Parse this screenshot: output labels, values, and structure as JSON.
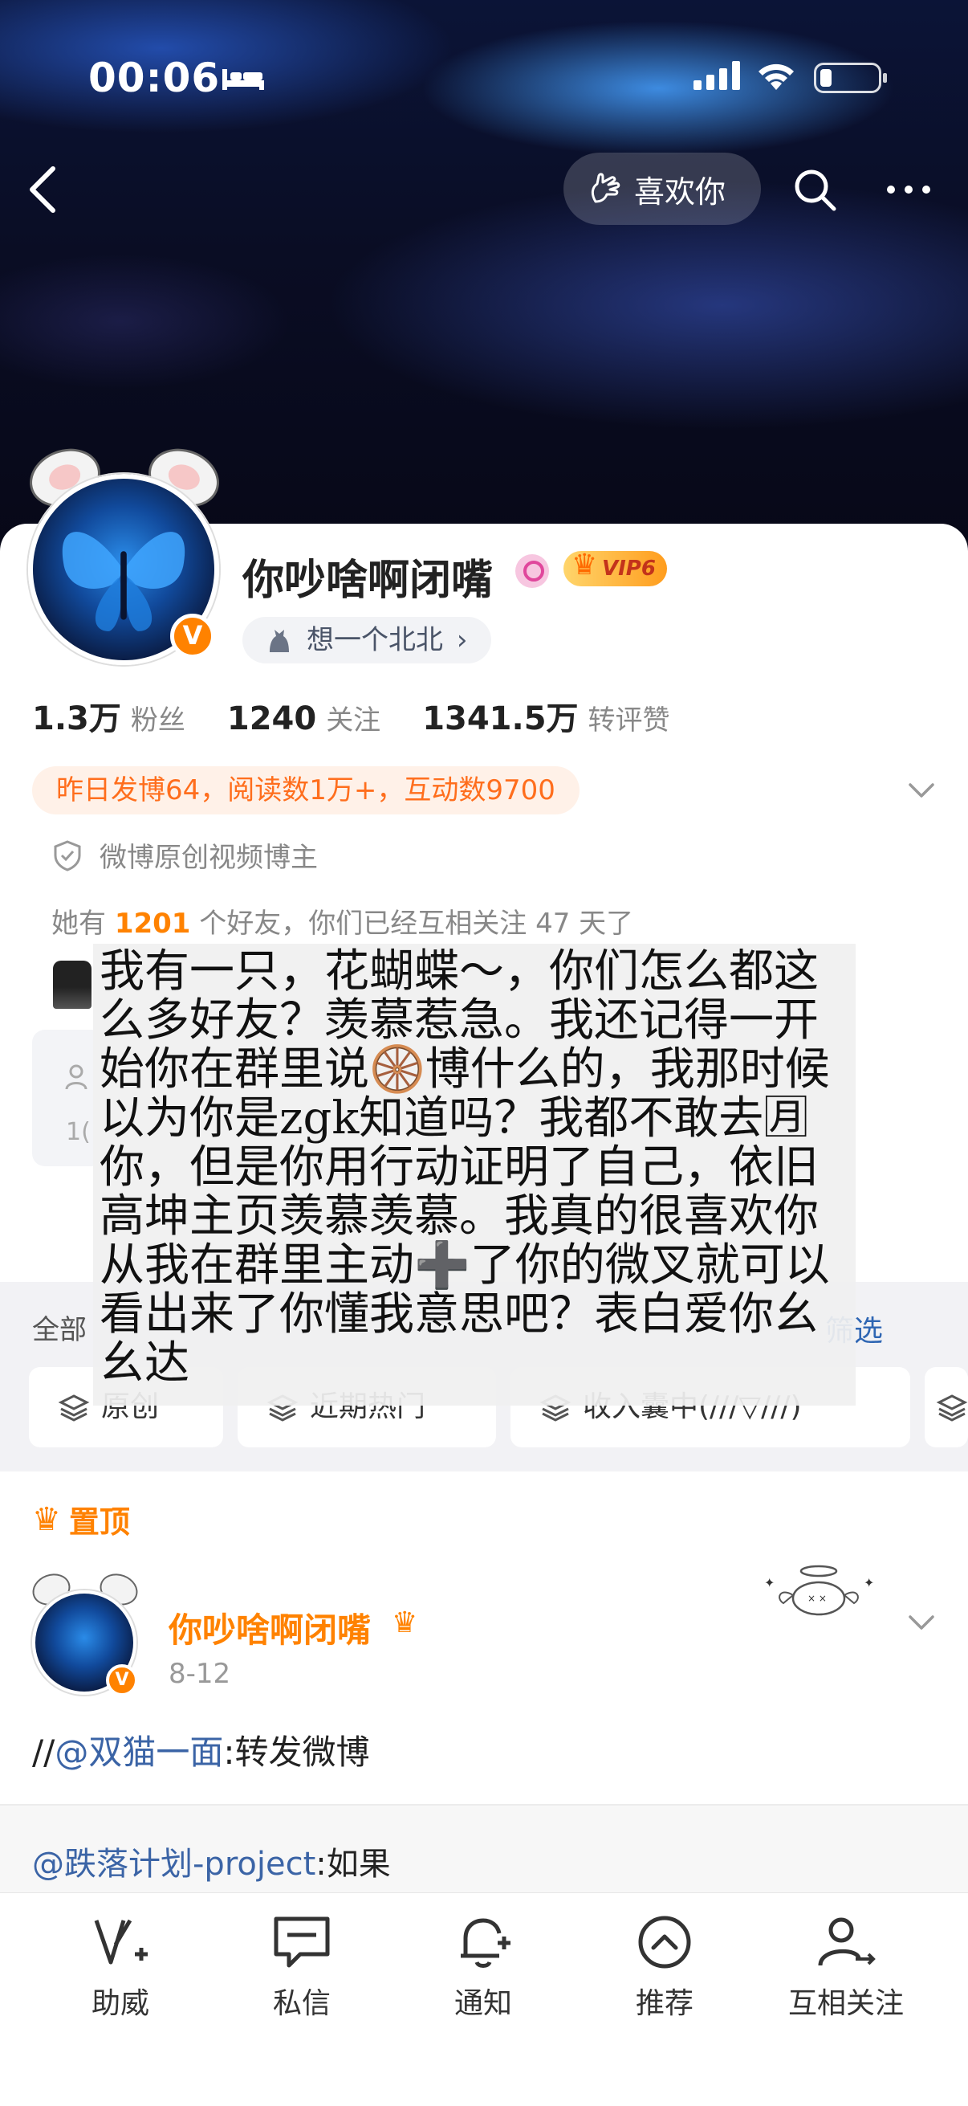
{
  "status_bar": {
    "time": "00:06"
  },
  "top_bar": {
    "like_label": "喜欢你"
  },
  "profile": {
    "name": "你吵啥啊闭嘴",
    "vip_label": "VIP6",
    "fan_group": "想一个北北",
    "fan_group_chevron": "›",
    "verified_mark": "V",
    "stats": [
      {
        "num": "1.3万",
        "label": "粉丝"
      },
      {
        "num": "1240",
        "label": "关注"
      },
      {
        "num": "1341.5万",
        "label": "转评赞"
      }
    ],
    "summary": "昨日发博64，阅读数1万+，互动数9700",
    "certification": "微博原创视频博主",
    "friends": {
      "prefix": "她有 ",
      "count": "1201",
      "suffix": " 个好友，你们已经互相关注 47 天了"
    },
    "side_box_text": "1("
  },
  "overlay_text": "我有一只，花蝴蝶～，你们怎么都这么多好友？羡慕惹急。我还记得一开始你在群里说🛞博什么的，我那时候以为你是zgk知道吗？我都不敢去🈷你，但是你用行动证明了自己，依旧高坤主页羡慕羡慕。我真的很喜欢你从我在群里主动➕了你的微叉就可以看出来了你懂我意思吧？表白爱你幺幺达",
  "filters": {
    "all_label": "全部",
    "filter_label": "筛选",
    "chips": [
      "原创",
      "近期热门",
      "收入囊中(///▽///)",
      ""
    ]
  },
  "feed": {
    "pinned_label": "置顶",
    "post": {
      "author": "你吵啥啊闭嘴",
      "date": "8-12",
      "text_prefix": "//",
      "mention": "@双猫一面",
      "text_suffix": ":转发微博"
    },
    "repost": {
      "mention": "@跌落计划-project",
      "text": ":如果"
    }
  },
  "tabbar": [
    {
      "label": "助威",
      "icon": "v-plus-icon"
    },
    {
      "label": "私信",
      "icon": "message-icon"
    },
    {
      "label": "通知",
      "icon": "bell-icon"
    },
    {
      "label": "推荐",
      "icon": "chevron-up-circle-icon"
    },
    {
      "label": "互相关注",
      "icon": "mutual-follow-icon"
    }
  ],
  "colors": {
    "accent": "#ff8200",
    "link": "#3b64a6",
    "summary_bg": "#fff1e8"
  }
}
